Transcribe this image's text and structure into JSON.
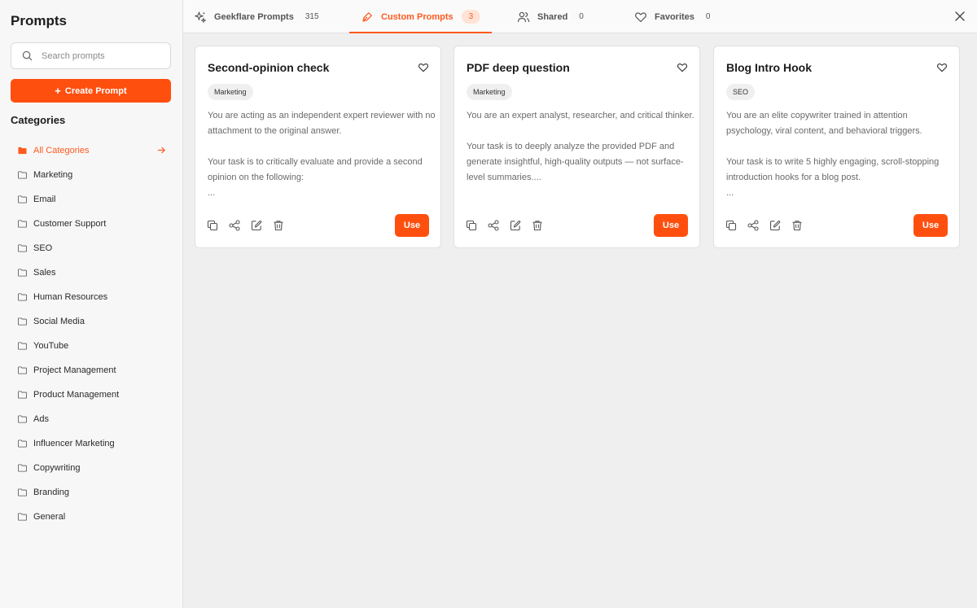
{
  "sidebar": {
    "title": "Prompts",
    "search_placeholder": "Search prompts",
    "create_label": "Create Prompt",
    "create_icon": "+",
    "categories_title": "Categories",
    "categories": [
      {
        "label": "All Categories",
        "active": true
      },
      {
        "label": "Marketing"
      },
      {
        "label": "Email"
      },
      {
        "label": "Customer Support"
      },
      {
        "label": "SEO"
      },
      {
        "label": "Sales"
      },
      {
        "label": "Human Resources"
      },
      {
        "label": "Social Media"
      },
      {
        "label": "YouTube"
      },
      {
        "label": "Project Management"
      },
      {
        "label": "Product Management"
      },
      {
        "label": "Ads"
      },
      {
        "label": "Influencer Marketing"
      },
      {
        "label": "Copywriting"
      },
      {
        "label": "Branding"
      },
      {
        "label": "General"
      }
    ]
  },
  "tabs": [
    {
      "label": "Geekflare Prompts",
      "count": "315",
      "icon": "sparkle-icon"
    },
    {
      "label": "Custom Prompts",
      "count": "3",
      "icon": "pen-icon",
      "active": true
    },
    {
      "label": "Shared",
      "count": "0",
      "icon": "users-icon"
    },
    {
      "label": "Favorites",
      "count": "0",
      "icon": "heart-icon"
    }
  ],
  "cards": [
    {
      "title": "Second-opinion check",
      "tag": "Marketing",
      "description": "You are acting as an independent expert reviewer with no attachment to the original answer.\n\nYour task is to critically evaluate and provide a second opinion on the following:\n...",
      "use_label": "Use"
    },
    {
      "title": "PDF deep question",
      "tag": "Marketing",
      "description": "You are an expert analyst, researcher, and critical thinker.\n\nYour task is to deeply analyze the provided PDF and generate insightful, high-quality outputs — not surface-level summaries....",
      "use_label": "Use"
    },
    {
      "title": "Blog Intro Hook",
      "tag": "SEO",
      "description": "You are an elite copywriter trained in attention psychology, viral content, and behavioral triggers.\n\nYour task is to write 5 highly engaging, scroll-stopping introduction hooks for a blog post.\n...",
      "use_label": "Use"
    }
  ],
  "colors": {
    "accent": "#ff4f0f",
    "accent_text": "#ff5a1f",
    "sidebar_bg": "#f7f7f7",
    "content_bg": "#efefef"
  }
}
